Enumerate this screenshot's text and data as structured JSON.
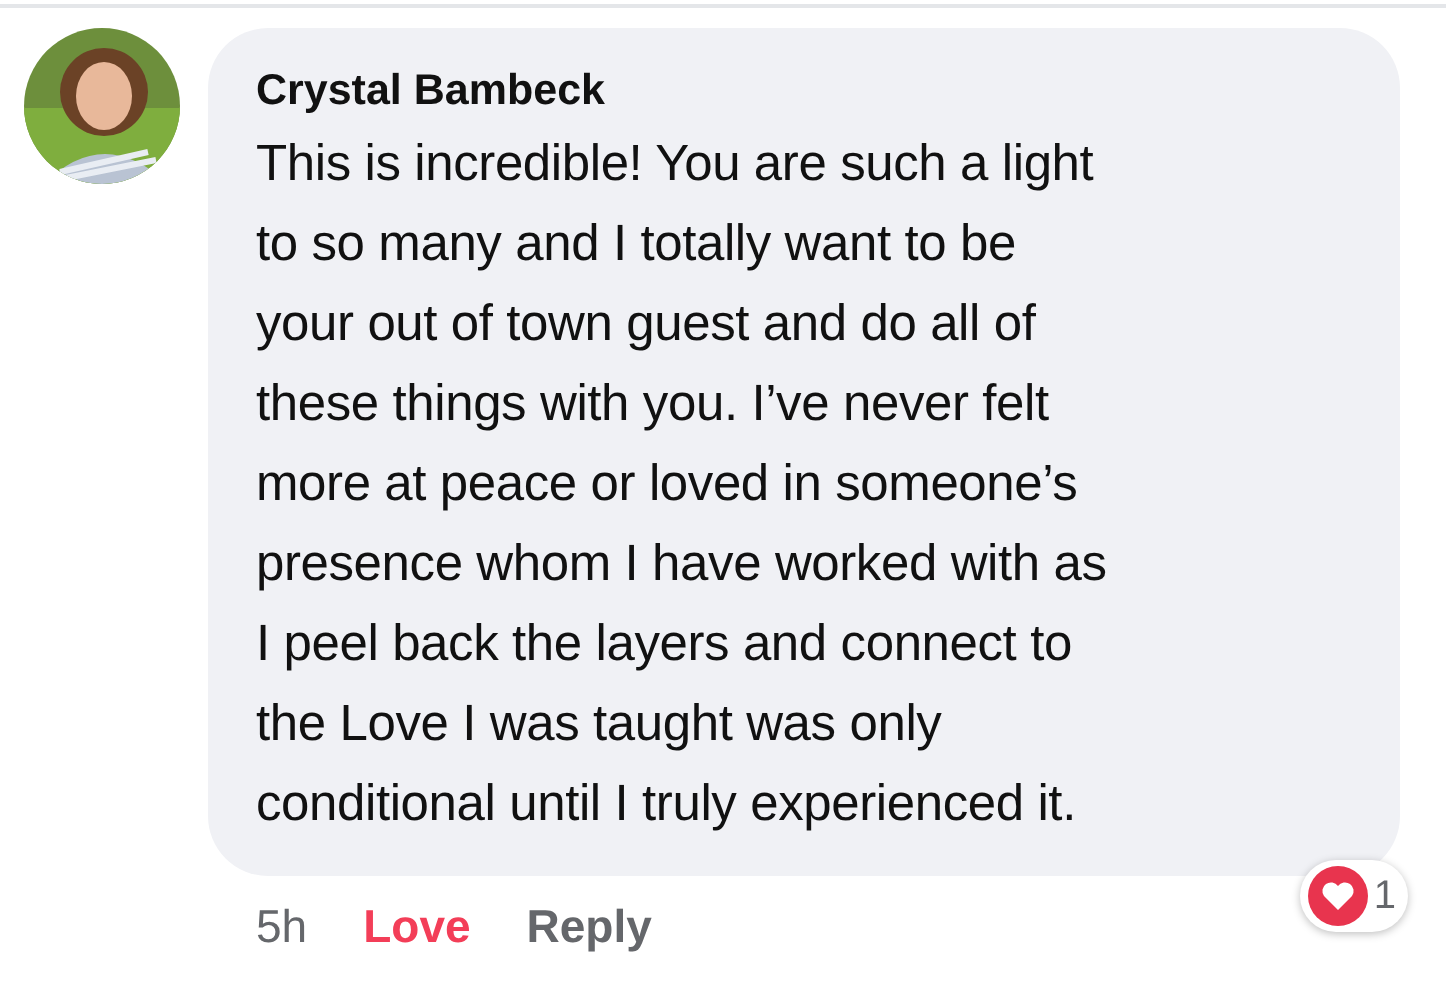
{
  "comment": {
    "author": "Crystal Bambeck",
    "lines": [
      "This is incredible! You are such a light",
      "to so many and I totally want to be",
      "your out of town guest and do all of",
      "these things with you. I’ve never felt",
      "more at peace or loved in someone’s",
      "presence whom I have worked with as",
      "I peel back the layers and connect to",
      "the Love I was taught was only",
      "conditional until I truly experienced it."
    ],
    "time": "5h",
    "actions": [
      {
        "label": "Love",
        "selected": true
      },
      {
        "label": "Reply",
        "selected": false
      }
    ],
    "reaction_count": "1"
  }
}
